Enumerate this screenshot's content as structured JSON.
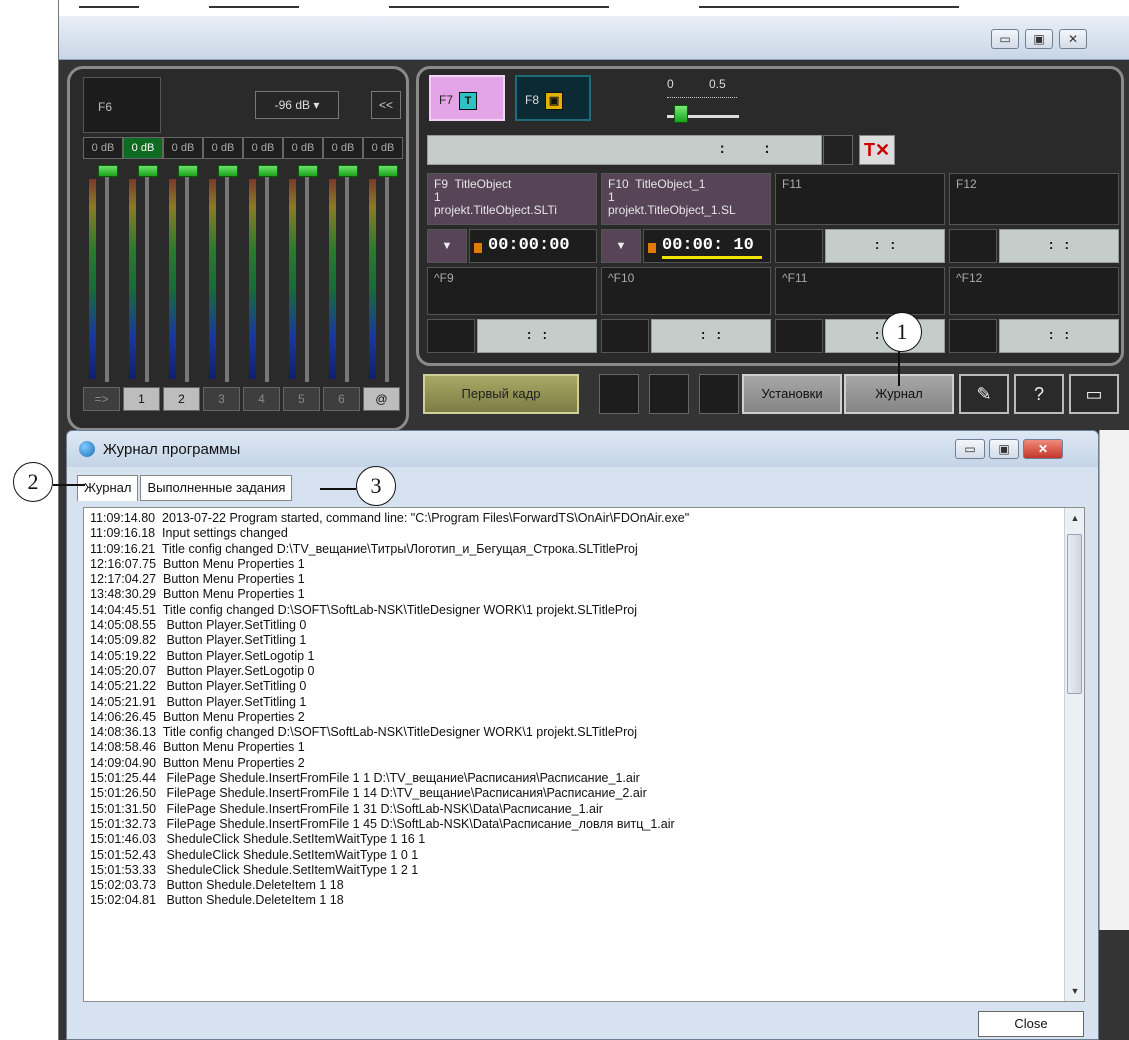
{
  "outer_window": {
    "buttons": [
      "▭",
      "▣",
      "✕"
    ]
  },
  "audio": {
    "preset_label": "F6",
    "db_select": "-96 dB ▾",
    "collapse_label": "<<",
    "gains": [
      "0 dB",
      "0 dB",
      "0 dB",
      "0 dB",
      "0 dB",
      "0 dB",
      "0 dB",
      "0 dB"
    ],
    "active_gain_index": 1,
    "channels": [
      "=>",
      "1",
      "2",
      "3",
      "4",
      "5",
      "6",
      "@"
    ]
  },
  "titling": {
    "f7_label": "F7",
    "f8_label": "F8",
    "f7_glyph": "T",
    "f8_glyph": "▣",
    "slider_min": "0",
    "slider_max": "0.5",
    "slider_value": 0.1,
    "timeline_tc": ": :",
    "clear_icon": "T✕",
    "slots": [
      {
        "label": "F9  TitleObject\n1\nprojekt.TitleObject.SLTi"
      },
      {
        "label": "F10  TitleObject_1\n1\nprojekt.TitleObject_1.SL"
      },
      {
        "label": "F11"
      },
      {
        "label": "F12"
      }
    ],
    "slot_times": [
      "00:00:00",
      "00:00: 10",
      ": :",
      ": :"
    ],
    "shift_slots": [
      "^F9",
      "^F10",
      "^F11",
      "^F12"
    ],
    "shift_times": [
      ": :",
      ": :",
      ": :",
      ": :"
    ],
    "dropdown_arrow": "▼"
  },
  "toolbar": {
    "first_frame": "Первый кадр",
    "settings": "Установки",
    "journal": "Журнал",
    "pen_icon": "✎",
    "help_icon": "?",
    "folder_icon": "▭"
  },
  "callouts": [
    "1",
    "2",
    "3"
  ],
  "dialog": {
    "title": "Журнал программы",
    "tabs": [
      "Журнал",
      "Выполненные задания"
    ],
    "log_lines": [
      "11:09:14.80  2013-07-22 Program started, command line: \"C:\\Program Files\\ForwardTS\\OnAir\\FDOnAir.exe\"",
      "11:09:16.18  Input settings changed",
      "11:09:16.21  Title config changed D:\\TV_вещание\\Титры\\Логотип_и_Бегущая_Строка.SLTitleProj",
      "12:16:07.75  Button Menu Properties 1",
      "12:17:04.27  Button Menu Properties 1",
      "13:48:30.29  Button Menu Properties 1",
      "14:04:45.51  Title config changed D:\\SOFT\\SoftLab-NSK\\TitleDesigner WORK\\1 projekt.SLTitleProj",
      "14:05:08.55   Button Player.SetTitling 0",
      "14:05:09.82   Button Player.SetTitling 1",
      "14:05:19.22   Button Player.SetLogotip 1",
      "14:05:20.07   Button Player.SetLogotip 0",
      "14:05:21.22   Button Player.SetTitling 0",
      "14:05:21.91   Button Player.SetTitling 1",
      "14:06:26.45  Button Menu Properties 2",
      "14:08:36.13  Title config changed D:\\SOFT\\SoftLab-NSK\\TitleDesigner WORK\\1 projekt.SLTitleProj",
      "14:08:58.46  Button Menu Properties 1",
      "14:09:04.90  Button Menu Properties 2",
      "15:01:25.44   FilePage Shedule.InsertFromFile 1 1 D:\\TV_вещание\\Расписания\\Расписание_1.air",
      "15:01:26.50   FilePage Shedule.InsertFromFile 1 14 D:\\TV_вещание\\Расписания\\Расписание_2.air",
      "15:01:31.50   FilePage Shedule.InsertFromFile 1 31 D:\\SoftLab-NSK\\Data\\Расписание_1.air",
      "15:01:32.73   FilePage Shedule.InsertFromFile 1 45 D:\\SoftLab-NSK\\Data\\Расписание_ловля витц_1.air",
      "15:01:46.03   SheduleClick Shedule.SetItemWaitType 1 16 1",
      "15:01:52.43   SheduleClick Shedule.SetItemWaitType 1 0 1",
      "15:01:53.33   SheduleClick Shedule.SetItemWaitType 1 2 1",
      "15:02:03.73   Button Shedule.DeleteItem 1 18",
      "15:02:04.81   Button Shedule.DeleteItem 1 18"
    ],
    "close_label": "Close",
    "window_buttons": [
      "▭",
      "▣",
      "✕"
    ],
    "scroll_up": "▲",
    "scroll_down": "▼"
  }
}
